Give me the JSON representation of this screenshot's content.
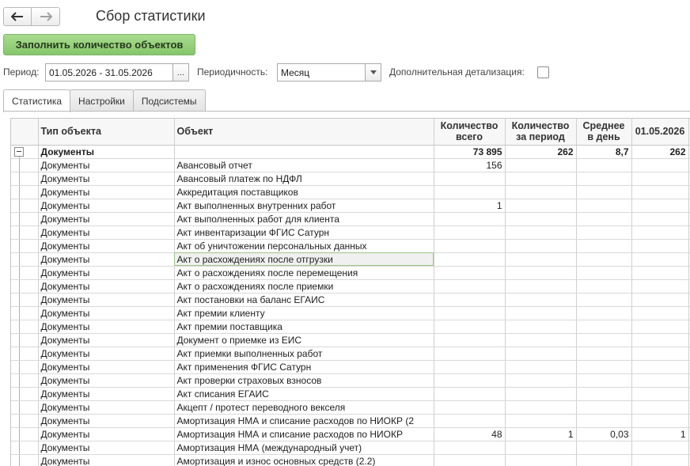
{
  "window": {
    "title": "Сбор статистики"
  },
  "actions": {
    "fill_label": "Заполнить количество объектов"
  },
  "filters": {
    "period_label": "Период:",
    "period_value": "01.05.2026 - 31.05.2026",
    "period_button": "...",
    "periodicity_label": "Периодичность:",
    "periodicity_value": "Месяц",
    "detail_label": "Дополнительная детализация:",
    "detail_checked": false
  },
  "tabs": [
    {
      "label": "Статистика",
      "active": true
    },
    {
      "label": "Настройки",
      "active": false
    },
    {
      "label": "Подсистемы",
      "active": false
    }
  ],
  "table": {
    "columns": [
      "Тип объекта",
      "Объект",
      "Количество всего",
      "Количество за период",
      "Среднее в день",
      "01.05.2026"
    ],
    "group": {
      "type": "Документы",
      "total": "73 895",
      "period": "262",
      "avg": "8,7",
      "d1": "262"
    },
    "rows": [
      {
        "type": "Документы",
        "object": "Авансовый отчет",
        "total": "156",
        "period": "",
        "avg": "",
        "d1": ""
      },
      {
        "type": "Документы",
        "object": "Авансовый платеж по НДФЛ",
        "total": "",
        "period": "",
        "avg": "",
        "d1": ""
      },
      {
        "type": "Документы",
        "object": "Аккредитация поставщиков",
        "total": "",
        "period": "",
        "avg": "",
        "d1": ""
      },
      {
        "type": "Документы",
        "object": "Акт выполненных внутренних работ",
        "total": "1",
        "period": "",
        "avg": "",
        "d1": ""
      },
      {
        "type": "Документы",
        "object": "Акт выполненных работ для клиента",
        "total": "",
        "period": "",
        "avg": "",
        "d1": ""
      },
      {
        "type": "Документы",
        "object": "Акт инвентаризации ФГИС Сатурн",
        "total": "",
        "period": "",
        "avg": "",
        "d1": ""
      },
      {
        "type": "Документы",
        "object": "Акт об уничтожении персональных данных",
        "total": "",
        "period": "",
        "avg": "",
        "d1": ""
      },
      {
        "type": "Документы",
        "object": "Акт о расхождениях после отгрузки",
        "total": "",
        "period": "",
        "avg": "",
        "d1": "",
        "selected": true
      },
      {
        "type": "Документы",
        "object": "Акт о расхождениях после перемещения",
        "total": "",
        "period": "",
        "avg": "",
        "d1": ""
      },
      {
        "type": "Документы",
        "object": "Акт о расхождениях после приемки",
        "total": "",
        "period": "",
        "avg": "",
        "d1": ""
      },
      {
        "type": "Документы",
        "object": "Акт постановки на баланс ЕГАИС",
        "total": "",
        "period": "",
        "avg": "",
        "d1": ""
      },
      {
        "type": "Документы",
        "object": "Акт премии клиенту",
        "total": "",
        "period": "",
        "avg": "",
        "d1": ""
      },
      {
        "type": "Документы",
        "object": "Акт премии поставщика",
        "total": "",
        "period": "",
        "avg": "",
        "d1": ""
      },
      {
        "type": "Документы",
        "object": "Документ о приемке из ЕИС",
        "total": "",
        "period": "",
        "avg": "",
        "d1": ""
      },
      {
        "type": "Документы",
        "object": "Акт приемки выполненных работ",
        "total": "",
        "period": "",
        "avg": "",
        "d1": ""
      },
      {
        "type": "Документы",
        "object": "Акт применения ФГИС Сатурн",
        "total": "",
        "period": "",
        "avg": "",
        "d1": ""
      },
      {
        "type": "Документы",
        "object": "Акт проверки страховых взносов",
        "total": "",
        "period": "",
        "avg": "",
        "d1": ""
      },
      {
        "type": "Документы",
        "object": "Акт списания ЕГАИС",
        "total": "",
        "period": "",
        "avg": "",
        "d1": ""
      },
      {
        "type": "Документы",
        "object": "Акцепт / протест переводного векселя",
        "total": "",
        "period": "",
        "avg": "",
        "d1": ""
      },
      {
        "type": "Документы",
        "object": "Амортизация НМА и списание расходов по НИОКР (2",
        "total": "",
        "period": "",
        "avg": "",
        "d1": ""
      },
      {
        "type": "Документы",
        "object": "Амортизация НМА и списание расходов по НИОКР",
        "total": "48",
        "period": "1",
        "avg": "0,03",
        "d1": "1"
      },
      {
        "type": "Документы",
        "object": "Амортизация НМА (международный учет)",
        "total": "",
        "period": "",
        "avg": "",
        "d1": ""
      },
      {
        "type": "Документы",
        "object": "Амортизация и износ основных средств (2.2)",
        "total": "",
        "period": "",
        "avg": "",
        "d1": ""
      }
    ]
  }
}
